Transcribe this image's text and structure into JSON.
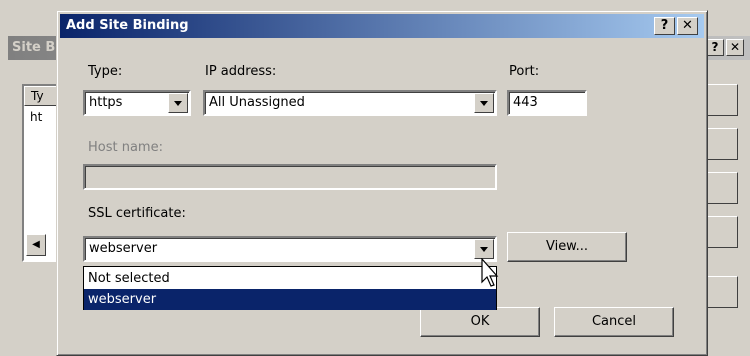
{
  "background_dialog": {
    "title": "Site B",
    "help_button": "?",
    "close_button": "✕",
    "list_header": "Ty",
    "list_row": "ht"
  },
  "dialog": {
    "title": "Add Site Binding",
    "help_button": "?",
    "close_button": "✕",
    "type": {
      "label": "Type:",
      "value": "https"
    },
    "ip_address": {
      "label": "IP address:",
      "value": "All Unassigned"
    },
    "port": {
      "label": "Port:",
      "value": "443"
    },
    "host_name": {
      "label": "Host name:",
      "value": ""
    },
    "ssl_certificate": {
      "label": "SSL certificate:",
      "value": "webserver",
      "options": [
        "Not selected",
        "webserver"
      ],
      "highlighted_option": "webserver"
    },
    "view_button": "View...",
    "ok_button": "OK",
    "cancel_button": "Cancel"
  }
}
